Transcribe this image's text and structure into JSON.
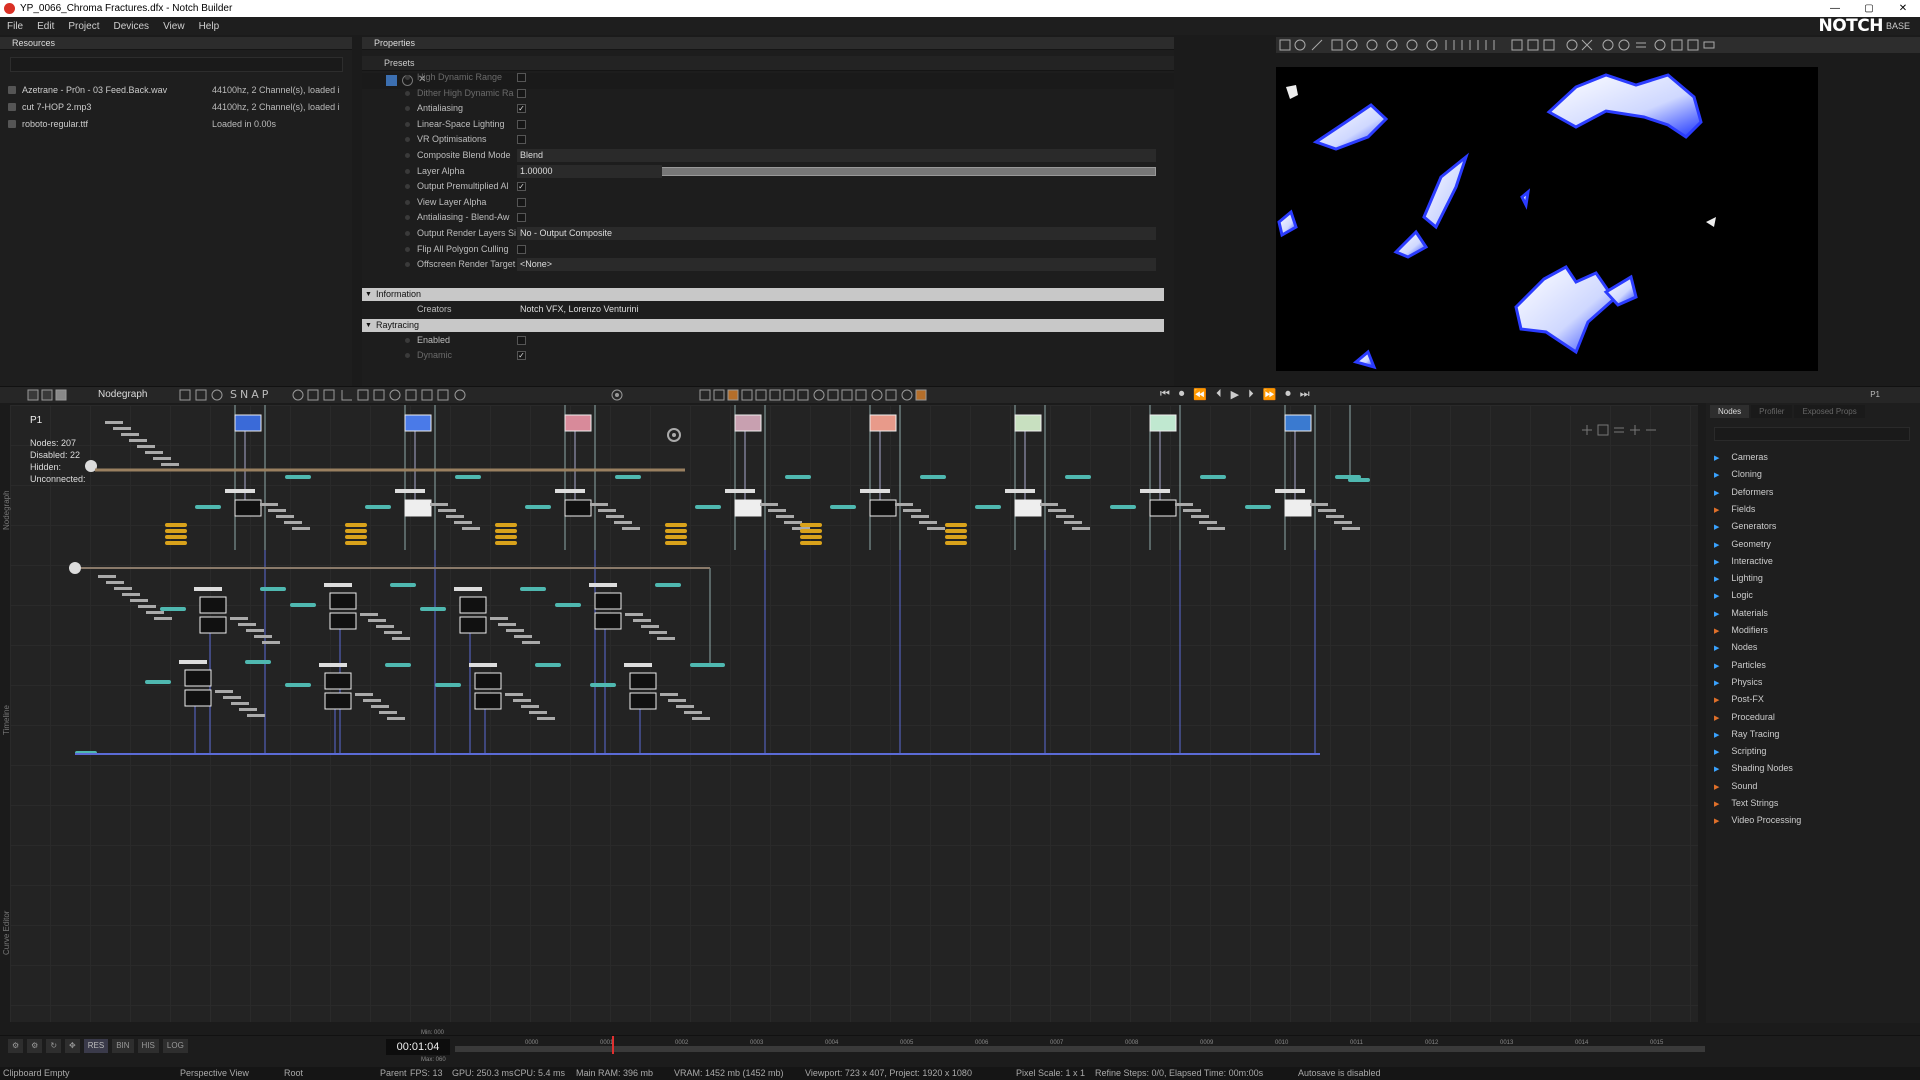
{
  "window": {
    "title": "YP_0066_Chroma Fractures.dfx - Notch Builder",
    "controls": [
      "—",
      "▢",
      "✕"
    ]
  },
  "menu": [
    "File",
    "Edit",
    "Project",
    "Devices",
    "View",
    "Help"
  ],
  "brand": {
    "logo": "NOTCH",
    "edition": "BASE"
  },
  "resources": {
    "title": "Resources",
    "items": [
      {
        "name": "Azetrane - Pr0n - 03 Feed.Back.wav",
        "status": "44100hz, 2 Channel(s), loaded i"
      },
      {
        "name": "cut 7-HOP 2.mp3",
        "status": "44100hz, 2 Channel(s), loaded i"
      },
      {
        "name": "roboto-regular.ttf",
        "status": "Loaded in 0.00s"
      }
    ]
  },
  "properties": {
    "title": "Properties",
    "presets": "Presets",
    "rows": [
      {
        "label": "High Dynamic Range",
        "type": "check",
        "checked": "",
        "dim": true
      },
      {
        "label": "Dither High Dynamic Ra",
        "type": "check",
        "checked": "",
        "dim": true
      },
      {
        "label": "Antialiasing",
        "type": "check",
        "checked": "✓",
        "dim": false
      },
      {
        "label": "Linear-Space Lighting",
        "type": "check",
        "checked": "",
        "dim": false
      },
      {
        "label": "VR Optimisations",
        "type": "check",
        "checked": "",
        "dim": false
      },
      {
        "label": "Composite Blend Mode",
        "type": "value",
        "value": "Blend",
        "dim": false
      },
      {
        "label": "Layer Alpha",
        "type": "value",
        "value": "1.00000",
        "dim": false
      },
      {
        "label": "Output Premultiplied Al",
        "type": "check",
        "checked": "✓",
        "dim": false
      },
      {
        "label": "View Layer Alpha",
        "type": "check",
        "checked": "",
        "dim": false
      },
      {
        "label": "Antialiasing - Blend-Aw",
        "type": "check",
        "checked": "",
        "dim": false
      },
      {
        "label": "Output Render Layers Si",
        "type": "value",
        "value": "No - Output Composite",
        "dim": false
      },
      {
        "label": "Flip All Polygon Culling",
        "type": "check",
        "checked": "",
        "dim": false
      },
      {
        "label": "Offscreen Render Target",
        "type": "value",
        "value": "<None>",
        "dim": false
      }
    ],
    "information": {
      "section": "Information",
      "label": "Creators",
      "value": "Notch VFX, Lorenzo Venturini"
    },
    "raytracing": {
      "section": "Raytracing",
      "rows": [
        {
          "label": "Enabled",
          "checked": ""
        },
        {
          "label": "Dynamic",
          "checked": "✓"
        }
      ]
    }
  },
  "nodegraph": {
    "tab": "Nodegraph",
    "snap": "SNAP",
    "layer": "P1",
    "stats": [
      {
        "label": "Nodes:",
        "value": "207"
      },
      {
        "label": "Disabled:",
        "value": "22"
      },
      {
        "label": "Hidden:",
        "value": ""
      },
      {
        "label": "Unconnected:",
        "value": ""
      }
    ],
    "side_labels": [
      "Nodegraph",
      "Timeline",
      "Curve Editor"
    ]
  },
  "nodes_panel": {
    "tabs": [
      "Nodes",
      "Profiler",
      "Exposed Props"
    ],
    "layer_tab": "P1",
    "categories": [
      "Cameras",
      "Cloning",
      "Deformers",
      "Fields",
      "Generators",
      "Geometry",
      "Interactive",
      "Lighting",
      "Logic",
      "Materials",
      "Modifiers",
      "Nodes",
      "Particles",
      "Physics",
      "Post-FX",
      "Procedural",
      "Ray Tracing",
      "Scripting",
      "Shading Nodes",
      "Sound",
      "Text Strings",
      "Video Processing"
    ]
  },
  "timeline": {
    "time": "00:01:04",
    "min": "Min: 000",
    "max": "Max: 060",
    "buttons": [
      "RES",
      "BIN",
      "HIS",
      "LOG"
    ],
    "ticks": [
      "0000",
      "0001",
      "0002",
      "0003",
      "0004",
      "0005",
      "0006",
      "0007",
      "0008",
      "0009",
      "0010",
      "0011",
      "0012",
      "0013",
      "0014",
      "0015"
    ]
  },
  "statusbar": {
    "clipboard": "Clipboard Empty",
    "view": "Perspective View",
    "root": "Root",
    "parent": "Parent",
    "fps": "FPS: 13",
    "gpu": "GPU: 250.3 ms",
    "cpu": "CPU: 5.4 ms",
    "ram": "Main RAM: 396 mb",
    "vram": "VRAM: 1452 mb (1452 mb)",
    "viewport": "Viewport: 723 x 407, Project: 1920 x 1080",
    "pixel_scale": "Pixel Scale: 1 x 1",
    "refine": "Refine Steps: 0/0, Elapsed Time: 00m:00s",
    "autosave": "Autosave is disabled"
  },
  "colors": {
    "accent_blue": "#3aa3ff",
    "node_teal": "#4fb8b0",
    "node_yellow": "#d9a21b",
    "wire_blue": "#5b6bd6"
  }
}
